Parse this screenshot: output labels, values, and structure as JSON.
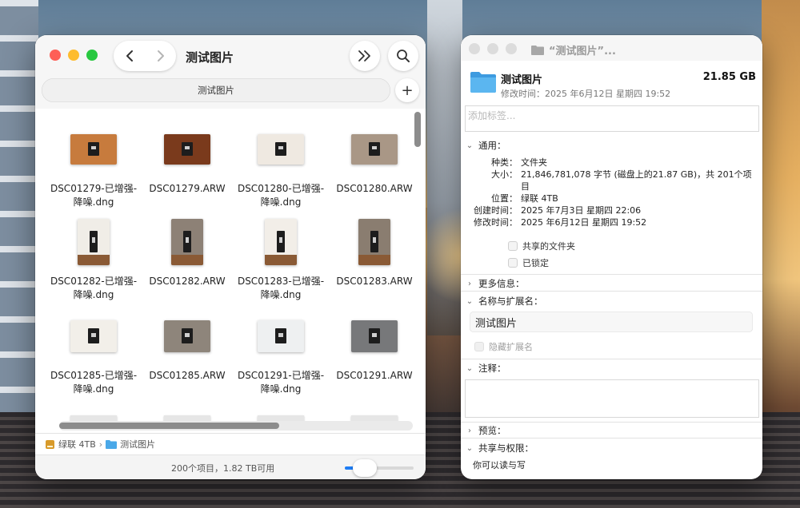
{
  "finder": {
    "title": "测试图片",
    "tab_label": "测试图片",
    "files": [
      {
        "name": "DSC01279-已增强-降噪.dng",
        "tone": "#c77b3d"
      },
      {
        "name": "DSC01279.ARW",
        "tone": "#7a3a1c"
      },
      {
        "name": "DSC01280-已增强-降噪.dng",
        "tone": "#efe9e1"
      },
      {
        "name": "DSC01280.ARW",
        "tone": "#a99786"
      },
      {
        "name": "DSC01282-已增强-降噪.dng",
        "tone": "#f0ede7"
      },
      {
        "name": "DSC01282.ARW",
        "tone": "#8d8176"
      },
      {
        "name": "DSC01283-已增强-降噪.dng",
        "tone": "#f2eee8"
      },
      {
        "name": "DSC01283.ARW",
        "tone": "#8a7d70"
      },
      {
        "name": "DSC01285-已增强-降噪.dng",
        "tone": "#f2efe9"
      },
      {
        "name": "DSC01285.ARW",
        "tone": "#8e857b"
      },
      {
        "name": "DSC01291-已增强-降噪.dng",
        "tone": "#eef0f1"
      },
      {
        "name": "DSC01291.ARW",
        "tone": "#77787a"
      }
    ],
    "path": {
      "drive": "绿联 4TB",
      "folder": "测试图片"
    },
    "status": "200个项目，1.82 TB可用"
  },
  "info": {
    "window_title": "“测试图片”...",
    "name": "测试图片",
    "size": "21.85 GB",
    "modified": "修改时间：2025 年6月12日 星期四 19:52",
    "tags_placeholder": "添加标签...",
    "sections": {
      "general": "通用：",
      "more": "更多信息：",
      "name_ext": "名称与扩展名：",
      "comments": "注释：",
      "preview": "预览：",
      "sharing": "共享与权限："
    },
    "general": {
      "kind_label": "种类：",
      "kind": "文件夹",
      "size_label": "大小：",
      "size": "21,846,781,078 字节 (磁盘上的21.87 GB)，共 201个项目",
      "where_label": "位置：",
      "where": "绿联 4TB",
      "created_label": "创建时间：",
      "created": "2025 年7月3日 星期四 22:06",
      "modified_label": "修改时间：",
      "modified": "2025 年6月12日 星期四 19:52",
      "shared_folder": "共享的文件夹",
      "locked": "已锁定"
    },
    "name_field": "测试图片",
    "hide_extension": "隐藏扩展名",
    "permission_text": "你可以读与写"
  },
  "colors": {
    "close": "#fe5f57",
    "minimize": "#febc2e",
    "zoom": "#28c840",
    "folder": "#4aa8e8",
    "accent": "#1e7df5"
  }
}
